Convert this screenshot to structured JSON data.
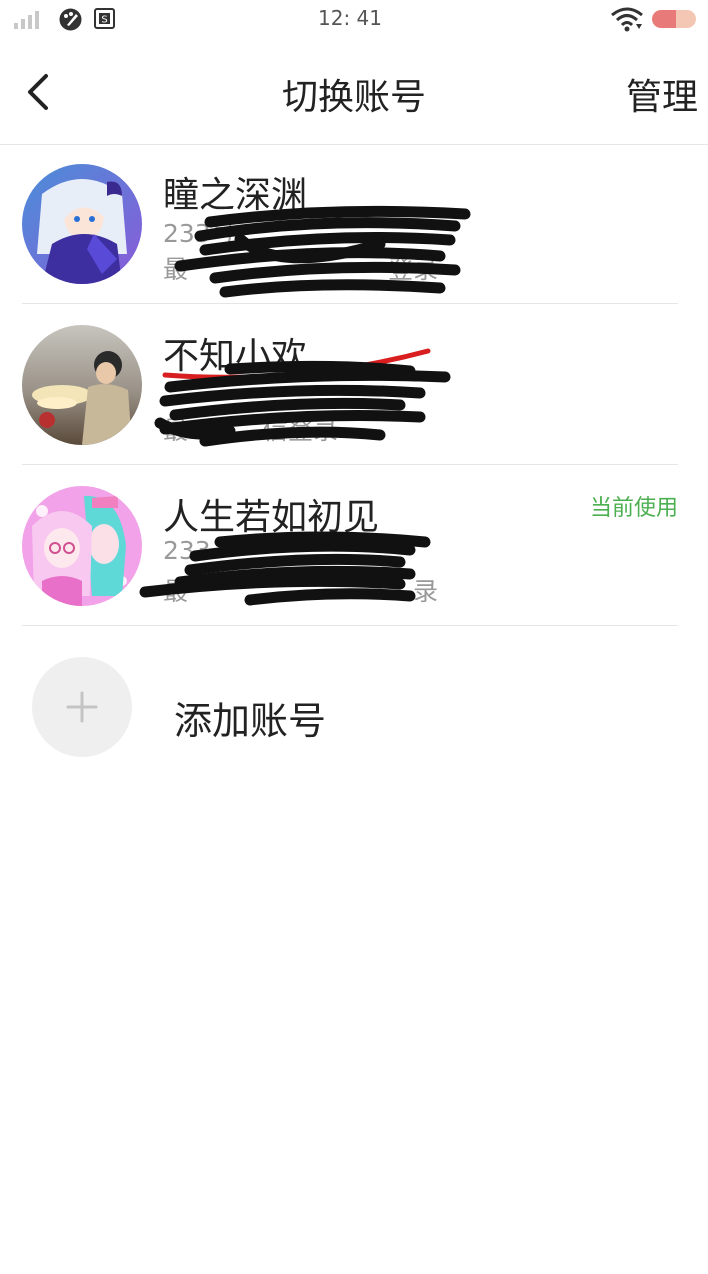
{
  "status_bar": {
    "time": "12: 41",
    "battery_level": 0.55,
    "colors": {
      "battery_fill": "#e87a7a",
      "battery_bg": "#f4c7b4"
    }
  },
  "nav": {
    "title": "切换账号",
    "manage_label": "管理",
    "back_icon": "chevron-left-icon"
  },
  "accounts": [
    {
      "name": "瞳之深渊",
      "line2": "233号",
      "line3": "最",
      "login_suffix": "登录",
      "current": false,
      "avatar": "anime-girl-avatar"
    },
    {
      "name": "不知小欢",
      "line2": "",
      "line3": "最",
      "login_suffix": "信登录",
      "current": false,
      "avatar": "anime-boy-sunset-avatar"
    },
    {
      "name": "人生若如初见",
      "line2": "233",
      "line3": "最",
      "login_suffix": "录",
      "current": true,
      "current_label": "当前使用",
      "avatar": "pink-anime-girls-avatar"
    }
  ],
  "add_account": {
    "label": "添加账号",
    "icon": "plus-icon"
  },
  "colors": {
    "accent_green": "#4caf50",
    "text_primary": "#222222",
    "text_secondary": "#999999",
    "divider": "#e6e6e6"
  }
}
